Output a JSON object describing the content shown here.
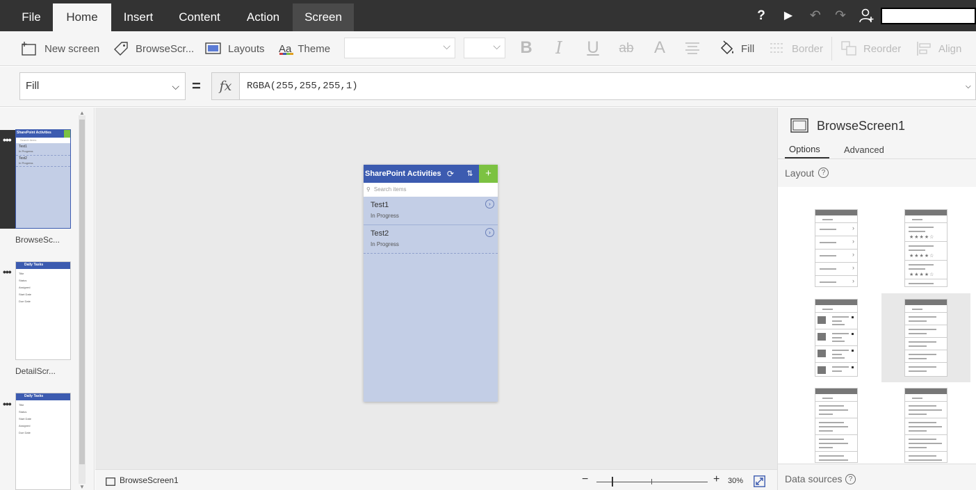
{
  "menu": {
    "tabs": [
      {
        "label": "File"
      },
      {
        "label": "Home"
      },
      {
        "label": "Insert"
      },
      {
        "label": "Content"
      },
      {
        "label": "Action"
      },
      {
        "label": "Screen"
      }
    ],
    "active_tab": "Home"
  },
  "topbar": {
    "help_icon": "?",
    "play_icon": "▶",
    "undo_icon": "↶",
    "redo_icon": "↷",
    "user_icon": "user-add"
  },
  "ribbon": {
    "new_screen": "New screen",
    "browse_screen": "BrowseScr...",
    "layouts": "Layouts",
    "theme_icon": "Aa",
    "theme": "Theme",
    "bold": "B",
    "italic": "I",
    "underline": "U",
    "strikethrough": "ab",
    "font_size_icon": "A",
    "fill": "Fill",
    "border": "Border",
    "reorder": "Reorder",
    "align": "Align"
  },
  "formula": {
    "property": "Fill",
    "equals": "=",
    "fx": "fx",
    "value": "RGBA(255,255,255,1)"
  },
  "screens": [
    {
      "label": "BrowseSc...",
      "selected": true,
      "mini_title": "SharePoint Activities",
      "mini_search": "Search items",
      "mini_items": [
        {
          "title": "Test1",
          "sub": "In Progress"
        },
        {
          "title": "Test2",
          "sub": "In Progress"
        }
      ]
    },
    {
      "label": "DetailScr...",
      "selected": false,
      "mini_title": "Daily Tasks",
      "mini_fields": [
        "Title",
        "Status",
        "Assigned",
        "Start Date",
        "Due Date"
      ]
    },
    {
      "label": "",
      "selected": false,
      "mini_title": "Daily Tasks",
      "mini_fields": [
        "Title",
        "Status",
        "Start Date",
        "Assigned",
        "Due Date"
      ]
    }
  ],
  "phone": {
    "title": "SharePoint Activities",
    "search_placeholder": "Search items",
    "add": "+",
    "items": [
      {
        "title": "Test1",
        "status": "In Progress"
      },
      {
        "title": "Test2",
        "status": "In Progress"
      }
    ],
    "colors": {
      "header": "#3c5bb0",
      "body": "#c3cee6",
      "add": "#7cc242"
    }
  },
  "statusbar": {
    "screen_name": "BrowseScreen1",
    "zoom_minus": "−",
    "zoom_plus": "+",
    "zoom_level": "30%"
  },
  "rightpanel": {
    "screen_name": "BrowseScreen1",
    "tabs": [
      {
        "label": "Options"
      },
      {
        "label": "Advanced"
      }
    ],
    "active_tab": "Options",
    "layout_label": "Layout",
    "help_icon": "?",
    "data_sources_label": "Data sources",
    "selected_layout": 4
  }
}
